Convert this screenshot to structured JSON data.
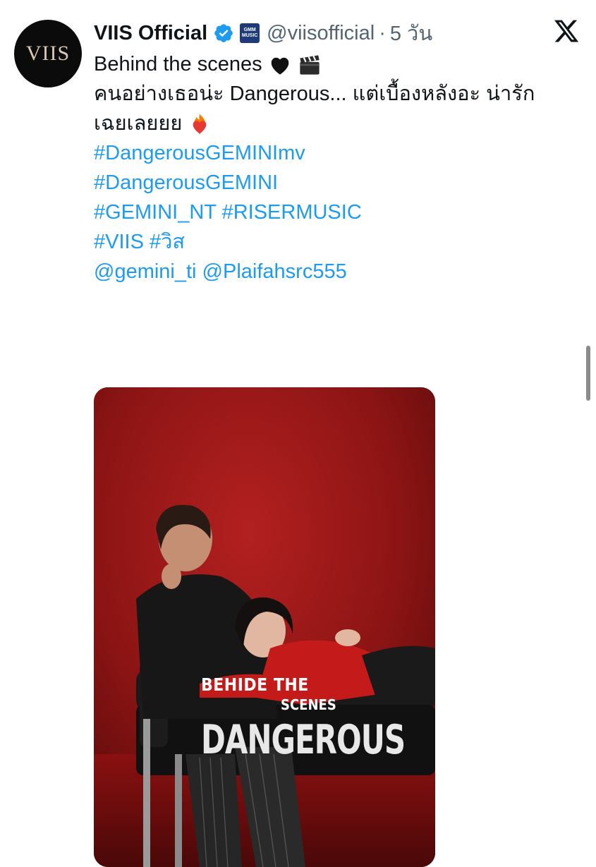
{
  "account": {
    "avatar_text": "VIIS",
    "name": "VIIS Official",
    "handle": "@viisofficial",
    "separator": "·",
    "time": "5 วัน",
    "affiliate_badge_line1": "GMM",
    "affiliate_badge_line2": "MUSIC"
  },
  "tweet": {
    "line1": "Behind the scenes",
    "line2": "คนอย่างเธอน่ะ Dangerous... แต่เบื้องหลังอะ น่ารัก",
    "line3": "เฉยเลยยย",
    "hashtags": [
      "#DangerousGEMINImv",
      "#DangerousGEMINI",
      "#GEMINI_NT #RISERMUSIC",
      "#VIIS #วิส"
    ],
    "mentions": "@gemini_ti @Plaifahsrc555"
  },
  "media": {
    "overlay_line1": "BEHIDE THE",
    "overlay_line2": "SCENES",
    "overlay_line3": "DANGEROUS"
  },
  "icons": {
    "verified": "verified-badge-icon",
    "platform": "x-logo-icon",
    "emoji1": "black-heart-icon",
    "emoji2": "clapper-board-icon",
    "emoji3": "heart-on-fire-icon"
  },
  "colors": {
    "link": "#1d9bf0",
    "secondary_text": "#536471",
    "verified_badge": "#1d9bf0"
  }
}
